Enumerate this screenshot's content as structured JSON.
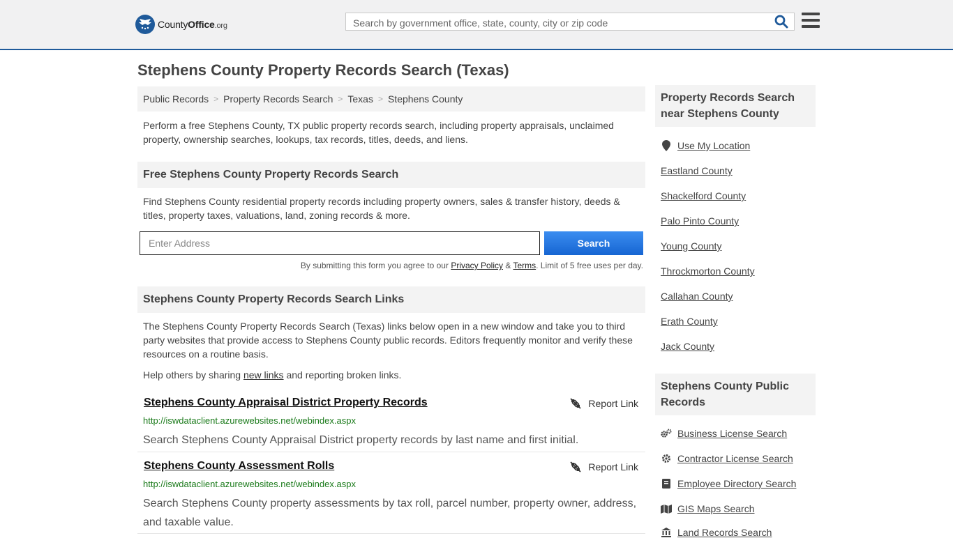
{
  "header": {
    "logo": {
      "word1": "County",
      "word2": "Office",
      "suffix": ".org"
    },
    "search_placeholder": "Search by government office, state, county, city or zip code",
    "icons": {
      "search": "search-icon",
      "menu": "hamburger-menu-icon"
    }
  },
  "page": {
    "title": "Stephens County Property Records Search (Texas)",
    "breadcrumb": [
      "Public Records",
      "Property Records Search",
      "Texas",
      "Stephens County"
    ],
    "intro": "Perform a free Stephens County, TX public property records search, including property appraisals, unclaimed property, ownership searches, lookups, tax records, titles, deeds, and liens."
  },
  "free_search": {
    "heading": "Free Stephens County Property Records Search",
    "description": "Find Stephens County residential property records including property owners, sales & transfer history, deeds & titles, property taxes, valuations, land, zoning records & more.",
    "address_placeholder": "Enter Address",
    "button": "Search",
    "disclaimer_pre": "By submitting this form you agree to our ",
    "privacy": "Privacy Policy",
    "amp": " & ",
    "terms": "Terms",
    "disclaimer_post": ". Limit of 5 free uses per day."
  },
  "links_section": {
    "heading": "Stephens County Property Records Search Links",
    "description": "The Stephens County Property Records Search (Texas) links below open in a new window and take you to third party websites that provide access to Stephens County public records. Editors frequently monitor and verify these resources on a routine basis.",
    "help_pre": "Help others by sharing ",
    "help_link": "new links",
    "help_post": " and reporting broken links.",
    "report_label": "Report Link",
    "records": [
      {
        "title": "Stephens County Appraisal District Property Records",
        "url": "http://iswdataclient.azurewebsites.net/webindex.aspx",
        "description": "Search Stephens County Appraisal District property records by last name and first initial."
      },
      {
        "title": "Stephens County Assessment Rolls",
        "url": "http://iswdataclient.azurewebsites.net/webindex.aspx",
        "description": "Search Stephens County property assessments by tax roll, parcel number, property owner, address, and taxable value."
      }
    ]
  },
  "sidebar": {
    "nearby_heading": "Property Records Search near Stephens County",
    "use_location": "Use My Location",
    "counties": [
      "Eastland County",
      "Shackelford County",
      "Palo Pinto County",
      "Young County",
      "Throckmorton County",
      "Callahan County",
      "Erath County",
      "Jack County"
    ],
    "public_records_heading": "Stephens County Public Records",
    "public_records": [
      {
        "label": "Business License Search",
        "icon": "gears-icon"
      },
      {
        "label": "Contractor License Search",
        "icon": "gear-icon"
      },
      {
        "label": "Employee Directory Search",
        "icon": "book-icon"
      },
      {
        "label": "GIS Maps Search",
        "icon": "map-icon"
      },
      {
        "label": "Land Records Search",
        "icon": "landmark-icon"
      }
    ]
  },
  "colors": {
    "accent": "#1f5a9a",
    "button": "#1a6fe0",
    "url": "#1a7a1a"
  }
}
